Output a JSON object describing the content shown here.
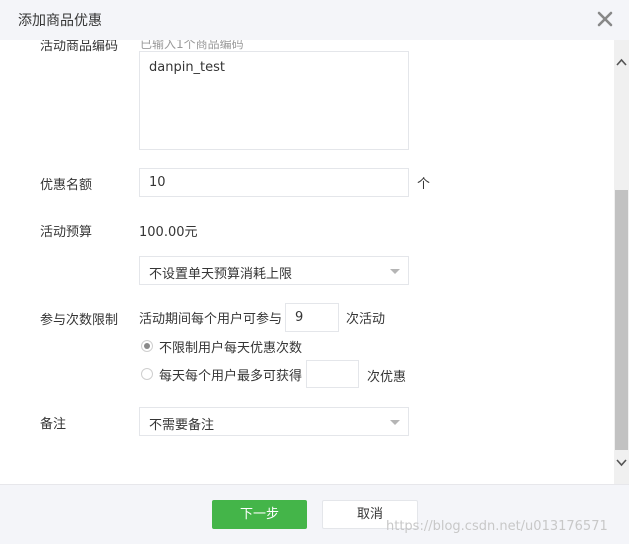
{
  "dialog": {
    "title": "添加商品优惠",
    "close_icon": "close-icon"
  },
  "form": {
    "product_code_label_clipped": "活动商品编码",
    "product_code_hint_clipped": "已输入1个商品编码",
    "product_code_value": "danpin_test",
    "quota_label": "优惠名额",
    "quota_value": "10",
    "quota_unit": "个",
    "budget_label": "活动预算",
    "budget_value": "100.00元",
    "daily_budget_select": "不设置单天预算消耗上限",
    "limit_label": "参与次数限制",
    "limit_prefix": "活动期间每个用户可参与",
    "limit_value": "9",
    "limit_suffix": "次活动",
    "radio_options": [
      {
        "label": "不限制用户每天优惠次数",
        "checked": true
      },
      {
        "label": "每天每个用户最多可获得",
        "checked": false,
        "suffix": "次优惠",
        "value": ""
      }
    ],
    "remark_label": "备注",
    "remark_select": "不需要备注"
  },
  "footer": {
    "next_label": "下一步",
    "cancel_label": "取消",
    "watermark": "https://blog.csdn.net/u013176571"
  },
  "colors": {
    "primary": "#44b549",
    "header_bg": "#f4f5f9",
    "border": "#e4e6ea",
    "scroll_thumb": "#c2c2c2"
  }
}
